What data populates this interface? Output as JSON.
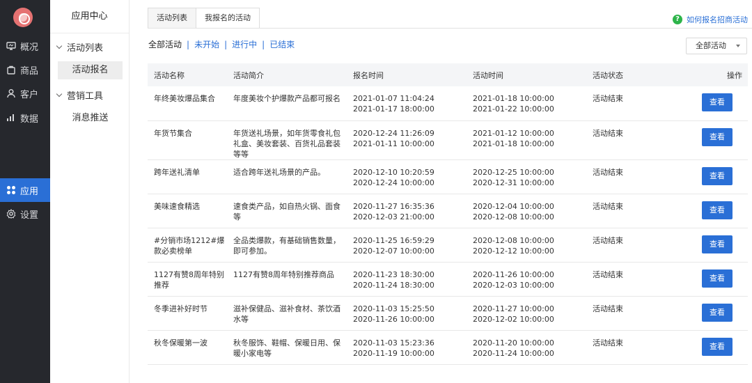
{
  "nav": {
    "items": [
      {
        "icon": "monitor-icon",
        "label": "概况"
      },
      {
        "icon": "bag-icon",
        "label": "商品"
      },
      {
        "icon": "user-icon",
        "label": "客户"
      },
      {
        "icon": "bar-chart-icon",
        "label": "数据"
      },
      {
        "icon": "grid-icon",
        "label": "应用"
      },
      {
        "icon": "gear-icon",
        "label": "设置"
      }
    ],
    "active": "应用"
  },
  "subnav": {
    "title": "应用中心",
    "groups": [
      {
        "label": "活动列表",
        "items": [
          "活动报名"
        ]
      },
      {
        "label": "营销工具",
        "items": [
          "消息推送"
        ]
      }
    ],
    "active_item": "活动报名"
  },
  "tabs": [
    "活动列表",
    "我报名的活动"
  ],
  "active_tab": "我报名的活动",
  "help_link": "如何报名招商活动",
  "filters": [
    "全部活动",
    "未开始",
    "进行中",
    "已结束"
  ],
  "filter_separator": "|",
  "select": {
    "value": "全部活动"
  },
  "table": {
    "headers": [
      "活动名称",
      "活动简介",
      "报名时间",
      "活动时间",
      "活动状态",
      "操作"
    ],
    "rows": [
      {
        "name": "年终美妆爆品集合",
        "desc": "年度美妆个护爆款产品都可报名",
        "signup_start": "2021-01-07 11:04:24",
        "signup_end": "2021-01-17 18:00:00",
        "act_start": "2021-01-18 10:00:00",
        "act_end": "2021-01-22 10:00:00",
        "status": "活动结束",
        "action": "查看"
      },
      {
        "name": "年货节集合",
        "desc": "年货送礼场景，如年货零食礼包礼盒、美妆套装、百货礼品套装等等",
        "signup_start": "2020-12-24 11:26:09",
        "signup_end": "2021-01-11 10:00:00",
        "act_start": "2021-01-12 10:00:00",
        "act_end": "2021-01-18 10:00:00",
        "status": "活动结束",
        "action": "查看"
      },
      {
        "name": "跨年送礼清单",
        "desc": "适合跨年送礼场景的产品。",
        "signup_start": "2020-12-10 10:20:59",
        "signup_end": "2020-12-24 10:00:00",
        "act_start": "2020-12-25 10:00:00",
        "act_end": "2020-12-31 10:00:00",
        "status": "活动结束",
        "action": "查看"
      },
      {
        "name": "美味速食精选",
        "desc": "速食类产品，如自热火锅、面食等",
        "signup_start": "2020-11-27 16:35:36",
        "signup_end": "2020-12-03 21:00:00",
        "act_start": "2020-12-04 10:00:00",
        "act_end": "2020-12-08 10:00:00",
        "status": "活动结束",
        "action": "查看"
      },
      {
        "name": "#分销市场1212#爆款必卖榜单",
        "desc": "全品类爆款，有基础销售数量，即可参加。",
        "signup_start": "2020-11-25 16:59:29",
        "signup_end": "2020-12-07 10:00:00",
        "act_start": "2020-12-08 10:00:00",
        "act_end": "2020-12-12 10:00:00",
        "status": "活动结束",
        "action": "查看"
      },
      {
        "name": "1127有赞8周年特别推荐",
        "desc": "1127有赞8周年特别推荐商品",
        "signup_start": "2020-11-23 18:30:00",
        "signup_end": "2020-11-24 18:30:00",
        "act_start": "2020-11-26 10:00:00",
        "act_end": "2020-12-03 10:00:00",
        "status": "活动结束",
        "action": "查看"
      },
      {
        "name": "冬季进补好时节",
        "desc": "滋补保健品、滋补食材、茶饮酒水等",
        "signup_start": "2020-11-03 15:25:50",
        "signup_end": "2020-11-26 10:00:00",
        "act_start": "2020-11-27 10:00:00",
        "act_end": "2020-12-02 10:00:00",
        "status": "活动结束",
        "action": "查看"
      },
      {
        "name": "秋冬保暖第一波",
        "desc": "秋冬服饰、鞋帽、保暖日用、保暖小家电等",
        "signup_start": "2020-11-03 15:23:36",
        "signup_end": "2020-11-19 10:00:00",
        "act_start": "2020-11-20 10:00:00",
        "act_end": "2020-11-24 10:00:00",
        "status": "活动结束",
        "action": "查看"
      }
    ]
  },
  "colors": {
    "accent": "#2a6fd6",
    "nav_bg": "#26282d",
    "help_icon": "#2db44a"
  }
}
